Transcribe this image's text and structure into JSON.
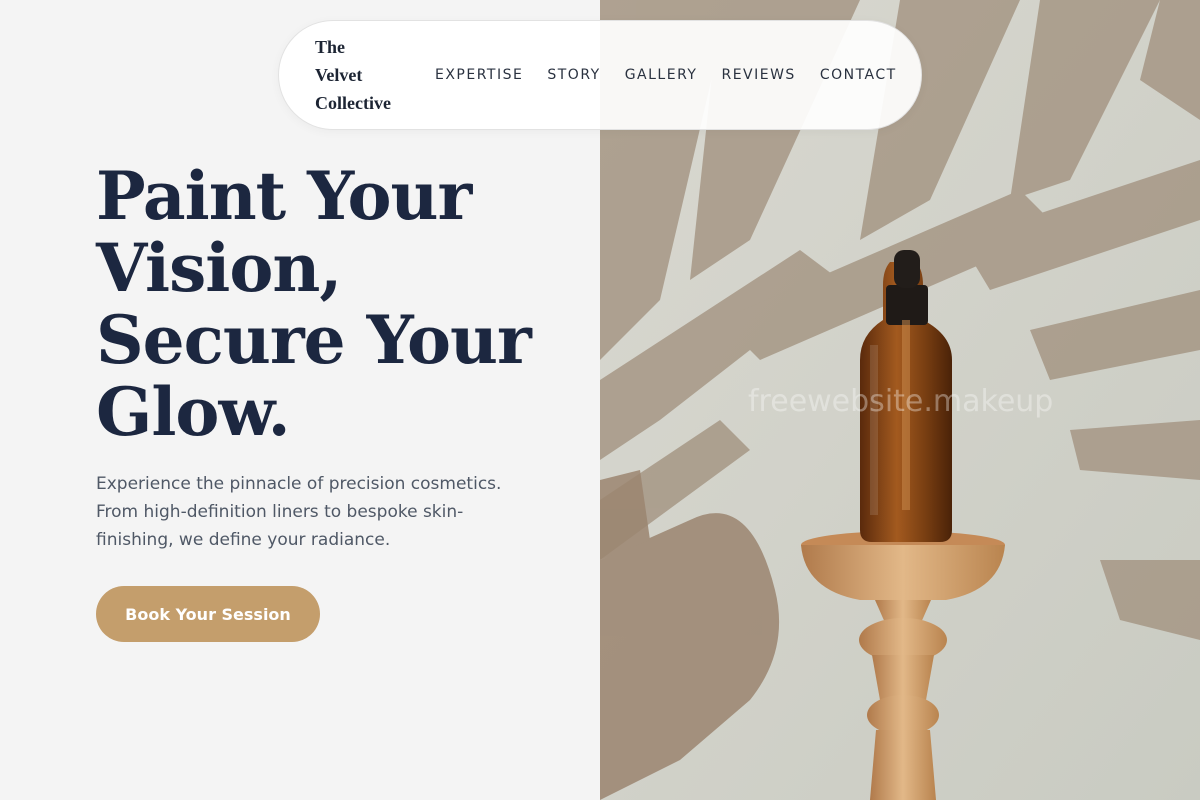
{
  "brand": {
    "lines": [
      "The",
      "Velvet",
      "Collective"
    ]
  },
  "nav": {
    "items": [
      {
        "label": "EXPERTISE"
      },
      {
        "label": "STORY"
      },
      {
        "label": "GALLERY"
      },
      {
        "label": "REVIEWS"
      },
      {
        "label": "CONTACT"
      }
    ]
  },
  "hero": {
    "title_lines": [
      "Paint Your",
      "Vision,",
      "Secure Your",
      "Glow."
    ],
    "subtitle": "Experience the pinnacle of precision cosmetics. From high-definition liners to bespoke skin-finishing, we define your radiance.",
    "cta_label": "Book Your Session"
  },
  "watermark": "freewebsite.makeup",
  "colors": {
    "background": "#f4f4f4",
    "title": "#1c2740",
    "accent": "#c49e6c",
    "body_text": "#4f5866"
  },
  "image": {
    "subject": "amber-dropper-bottle-on-wooden-pedestal-with-palm-shadows"
  }
}
